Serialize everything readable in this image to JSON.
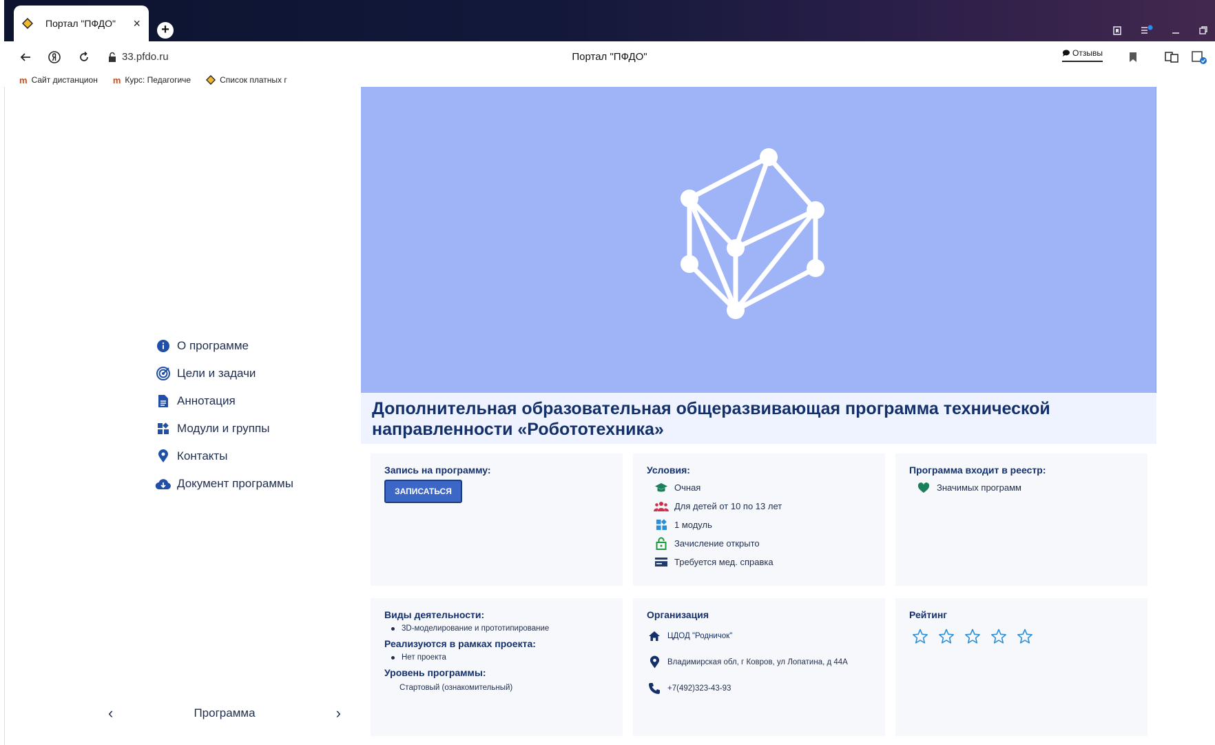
{
  "browser": {
    "tab_title": "Портал \"ПФДО\"",
    "tab_close": "×",
    "new_tab": "+",
    "url": "33.pfdo.ru",
    "page_title": "Портал \"ПФДО\"",
    "reviews_label": "Отзывы",
    "bookmarks": [
      {
        "label": "Сайт дистанцион",
        "icon": "moodle-icon"
      },
      {
        "label": "Курс: Педагогиче",
        "icon": "moodle-icon"
      },
      {
        "label": "Список платных г",
        "icon": "diamond-icon"
      }
    ]
  },
  "sidebar": {
    "items": [
      {
        "label": "О программе",
        "icon": "info-icon"
      },
      {
        "label": "Цели и задачи",
        "icon": "target-icon"
      },
      {
        "label": "Аннотация",
        "icon": "document-icon"
      },
      {
        "label": "Модули и группы",
        "icon": "modules-icon"
      },
      {
        "label": "Контакты",
        "icon": "location-icon"
      },
      {
        "label": "Документ программы",
        "icon": "cloud-download-icon"
      }
    ],
    "pager": {
      "prev": "‹",
      "label": "Программа",
      "next": "›"
    }
  },
  "program": {
    "title": "Дополнительная образовательная общеразвивающая программа технической направленности «Робототехника»",
    "hero_color": "#9fb3f7"
  },
  "enroll": {
    "heading": "Запись на программу:",
    "button": "ЗАПИСАТЬСЯ"
  },
  "conditions": {
    "heading": "Условия:",
    "items": [
      {
        "text": "Очная",
        "icon": "graduation-cap-icon",
        "color": "#1a7f5a"
      },
      {
        "text": "Для детей от 10 по 13 лет",
        "icon": "group-icon",
        "color": "#d0304a"
      },
      {
        "text": "1 модуль",
        "icon": "modules-icon",
        "color": "#2b8fd8"
      },
      {
        "text": "Зачисление открыто",
        "icon": "unlock-icon",
        "color": "#1b9a3a"
      },
      {
        "text": "Требуется мед. справка",
        "icon": "card-icon",
        "color": "#1f3a6e"
      }
    ]
  },
  "registry": {
    "heading": "Программа входит в реестр:",
    "item": "Значимых программ",
    "icon": "heart-icon",
    "color": "#1a7f5a"
  },
  "activities": {
    "heading": "Виды деятельности:",
    "item": "3D-моделирование и прототипирование",
    "project_heading": "Реализуются в рамках проекта:",
    "project_item": "Нет проекта",
    "level_heading": "Уровень программы:",
    "level_item": "Стартовый (ознакомительный)"
  },
  "organization": {
    "heading": "Организация",
    "name": "ЦДОД \"Родничок\"",
    "address": "Владимирская обл, г Ковров, ул Лопатина, д 44А",
    "phone": "+7(492)323-43-93"
  },
  "rating": {
    "heading": "Рейтинг",
    "stars": 5,
    "filled": 0,
    "color": "#2b8fd8"
  }
}
